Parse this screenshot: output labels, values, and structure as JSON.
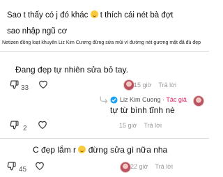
{
  "caption": {
    "line1_a": "Sao t thấy có j đó khác",
    "line1_b": "t thích cái nét bà đợt",
    "line2": "sao nhập ngũ cơ"
  },
  "notice": "Netizen đồng loạt khuyên Liz Kim Cương đừng sửa mũi vì đường nét gương mặt đã đủ đẹp",
  "comments": [
    {
      "text": "Đang đẹp tự nhiên sửa bỏ tay.",
      "time": "15 giờ",
      "reply": "Trả lời",
      "likes": "33"
    },
    {
      "author": "Liz Kim Cuong",
      "badge": "Tác giả",
      "text": "tự từ bình tĩnh nè",
      "time": "15 giờ",
      "reply": "Trả lời",
      "likes": "2"
    },
    {
      "text_a": "C đẹp lắm r",
      "text_b": "đừng sửa gì nữa nha",
      "time": "22 giờ",
      "reply": "Trả lời",
      "likes": "45"
    }
  ],
  "icons": {
    "dislike": "thumbs-down-icon",
    "like": "heart-icon",
    "reply": "reply-arrow-icon",
    "verified": "verified-check-icon",
    "emoji": "smiling-emoji-icon"
  },
  "colors": {
    "accent_pink": "#e0245e",
    "verified_blue": "#1da1f2"
  }
}
